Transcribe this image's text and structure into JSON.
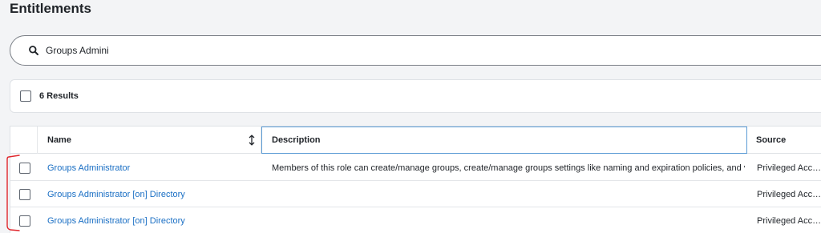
{
  "page": {
    "title": "Entitlements"
  },
  "search": {
    "value": "Groups Admini",
    "icon": "search-icon"
  },
  "results": {
    "count_label": "6 Results"
  },
  "table": {
    "columns": {
      "name": "Name",
      "description": "Description",
      "source": "Source"
    },
    "rows": [
      {
        "name": "Groups Administrator",
        "description": "Members of this role can create/manage groups, create/manage groups settings like naming and expiration policies, and vie…",
        "source": "Privileged Acc…"
      },
      {
        "name": "Groups Administrator [on] Directory",
        "description": "",
        "source": "Privileged Acc…"
      },
      {
        "name": "Groups Administrator [on] Directory",
        "description": "",
        "source": "Privileged Acc…"
      }
    ]
  },
  "colors": {
    "link": "#1a6fc4",
    "annotation": "#e0262c",
    "focus_border": "#5b9bd5"
  }
}
